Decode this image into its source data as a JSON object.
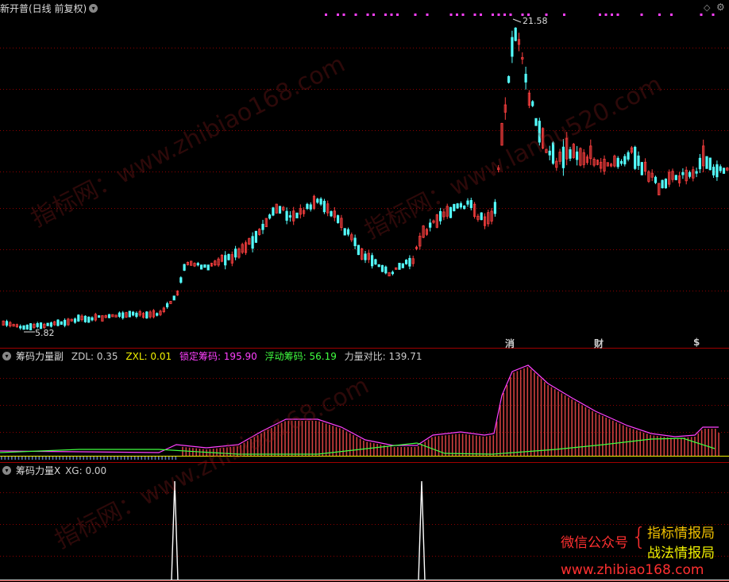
{
  "main_panel": {
    "title": "新开普(日线 前复权)",
    "high_label": "21.58",
    "low_label": "5.82",
    "events": [
      {
        "text": "消",
        "color": "#f0c000"
      },
      {
        "text": "财",
        "color": "#00bfff"
      },
      {
        "text": "$",
        "color": "#ff3030"
      }
    ]
  },
  "indicator1": {
    "name": "筹码力量副",
    "fields": [
      {
        "label": "ZDL: 0.35",
        "color": "#cccccc"
      },
      {
        "label": "ZXL: 0.01",
        "color": "#f0f000"
      },
      {
        "label": "锁定筹码: 195.90",
        "color": "#ff40ff"
      },
      {
        "label": "浮动筹码: 56.19",
        "color": "#40ff40"
      },
      {
        "label": "力量对比: 139.71",
        "color": "#cccccc"
      }
    ]
  },
  "indicator2": {
    "name": "筹码力量X",
    "fields": [
      {
        "label": "XG: 0.00",
        "color": "#cccccc"
      }
    ]
  },
  "watermarks": [
    "指标网：www.zhibiao168.com",
    "指标网：www.lanhu520.com",
    "指标网：www.zhibiao168.com"
  ],
  "branding": {
    "wechat_label": "微信公众号",
    "account1": "指标情报局",
    "account2": "战法情报局",
    "website": "www.zhibiao168.com"
  },
  "colors": {
    "up": "#ff4040",
    "down": "#54ffff",
    "grid": "#8b0000",
    "locked": "#ff40ff",
    "floating": "#40ff40"
  },
  "icons": [
    "chevron-down-icon",
    "diamond-icon",
    "gear-icon"
  ]
}
